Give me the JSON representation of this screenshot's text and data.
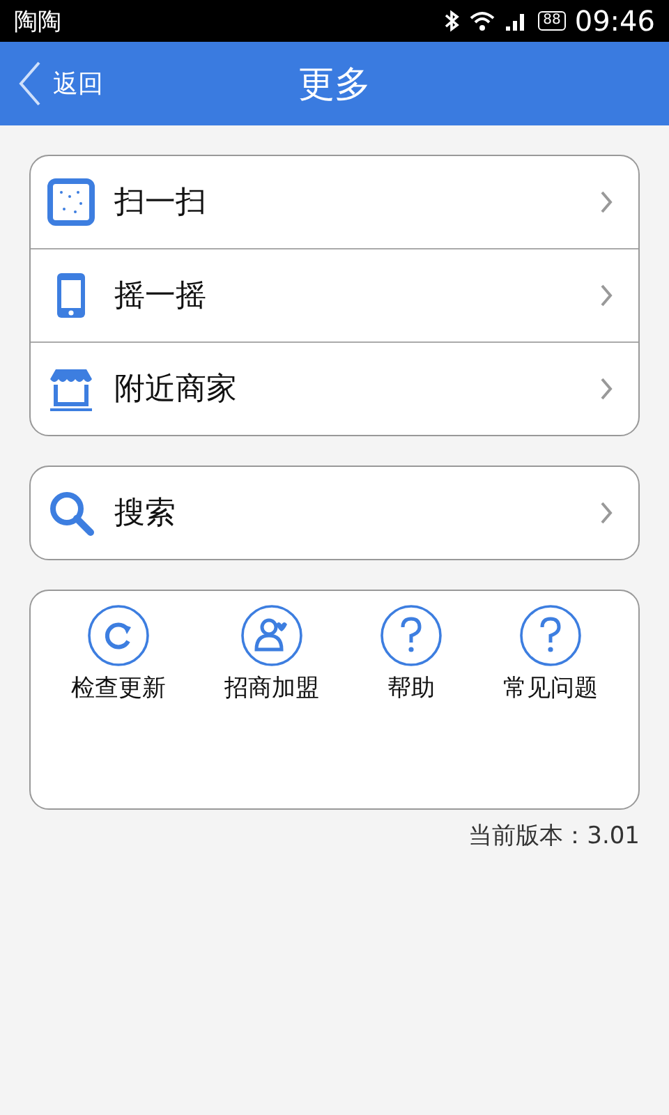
{
  "status_bar": {
    "app": "陶陶",
    "battery": "88",
    "time": "09:46"
  },
  "header": {
    "back": "返回",
    "title": "更多"
  },
  "menu_groups": [
    {
      "items": [
        {
          "label": "扫一扫",
          "kind": "scan"
        },
        {
          "label": "摇一摇",
          "kind": "phone"
        },
        {
          "label": "附近商家",
          "kind": "store"
        }
      ]
    },
    {
      "items": [
        {
          "label": "搜索",
          "kind": "search"
        }
      ]
    }
  ],
  "shortcuts": [
    {
      "label": "检查更新",
      "kind": "refresh"
    },
    {
      "label": "招商加盟",
      "kind": "user"
    },
    {
      "label": "帮助",
      "kind": "help"
    },
    {
      "label": "常见问题",
      "kind": "help"
    }
  ],
  "version": "当前版本：3.01"
}
